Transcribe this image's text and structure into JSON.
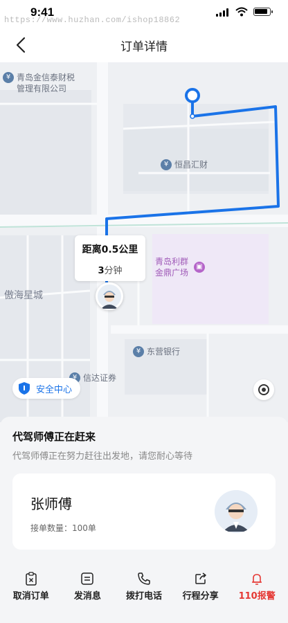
{
  "status_bar": {
    "time": "9:41",
    "watermark": "https://www.huzhan.com/ishop18862"
  },
  "nav": {
    "title": "订单详情"
  },
  "map": {
    "pois": [
      {
        "id": "qingdao-jinxintai",
        "text": "青岛金信泰财税管理有限公司"
      },
      {
        "id": "hengchang",
        "text": "恒昌汇财"
      },
      {
        "id": "lique",
        "text": "青岛利群金鼎广场"
      },
      {
        "id": "dongying-bank",
        "text": "东营银行"
      },
      {
        "id": "xinda",
        "text": "信达证券"
      }
    ],
    "areas": {
      "aohai": "傲海星城"
    },
    "distance_card": {
      "distance": "距离0.5公里",
      "eta_value": "3",
      "eta_unit": "分钟"
    },
    "safety_center": "安全中心",
    "route_color": "#1a73e8"
  },
  "sheet": {
    "title": "代驾师傅正在赶来",
    "subtitle": "代驾师傅正在努力赶往出发地，请您耐心等待",
    "driver": {
      "name": "张师傅",
      "order_count": "接单数量：100单"
    },
    "actions": [
      {
        "label": "取消订单",
        "icon": "clipboard-x-icon"
      },
      {
        "label": "发消息",
        "icon": "message-icon"
      },
      {
        "label": "拨打电话",
        "icon": "phone-icon"
      },
      {
        "label": "行程分享",
        "icon": "share-icon"
      },
      {
        "label": "110报警",
        "icon": "bell-icon",
        "color": "#e53935"
      }
    ]
  }
}
